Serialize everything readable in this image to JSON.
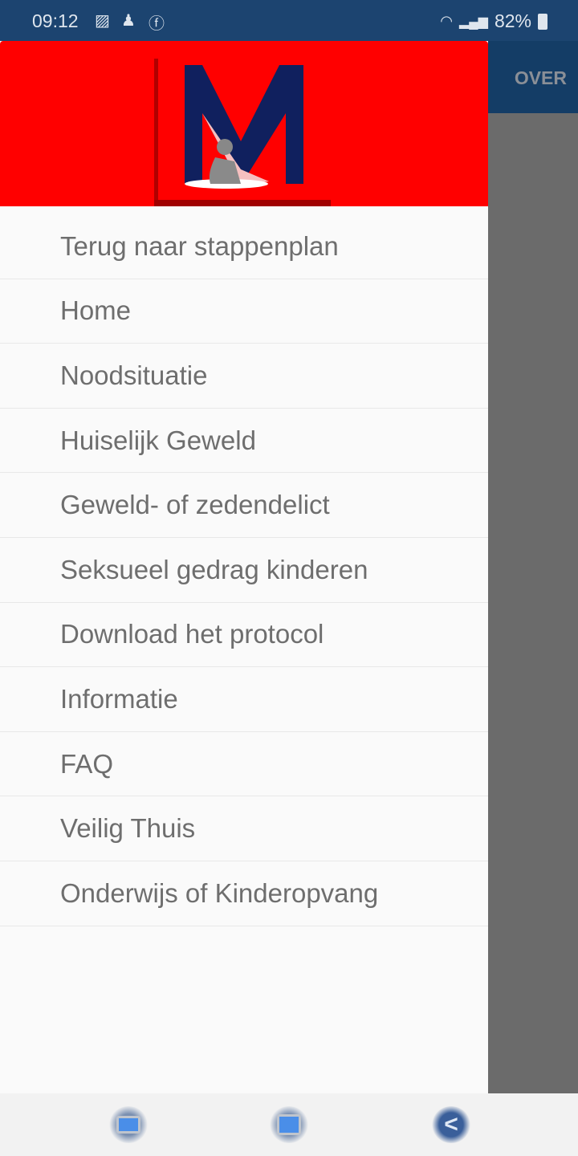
{
  "status_bar": {
    "time": "09:12",
    "notification_icons": [
      "image-icon",
      "snapchat-icon",
      "facebook-icon"
    ],
    "battery": "82%"
  },
  "toolbar": {
    "action_label": "OVER"
  },
  "drawer": {
    "header_logo": "M",
    "items": [
      {
        "label": "Terug naar stappenplan"
      },
      {
        "label": "Home"
      },
      {
        "label": "Noodsituatie"
      },
      {
        "label": "Huiselijk Geweld"
      },
      {
        "label": "Geweld- of zedendelict"
      },
      {
        "label": "Seksueel gedrag kinderen"
      },
      {
        "label": "Download het protocol"
      },
      {
        "label": "Informatie"
      },
      {
        "label": "FAQ"
      },
      {
        "label": "Veilig Thuis"
      },
      {
        "label": "Onderwijs of Kinderopvang"
      }
    ]
  },
  "colors": {
    "status_bar": "#1c4470",
    "header": "#ff0000",
    "logo": "#10205e"
  }
}
